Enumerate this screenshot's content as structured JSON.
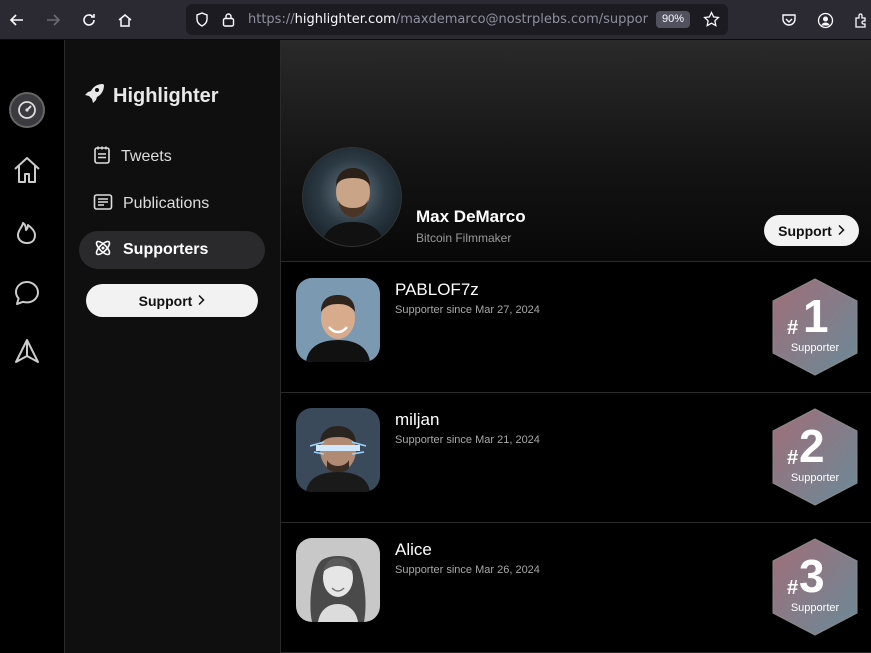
{
  "browser": {
    "url_prefix": "https://",
    "url_host": "highlighter.com",
    "url_path": "/maxdemarco@nostrplebs.com/suppor",
    "zoom": "90%"
  },
  "rail": {
    "icons": [
      "dashboard-icon",
      "home-icon",
      "flame-icon",
      "chat-icon",
      "send-icon"
    ]
  },
  "sidebar": {
    "brand": "Highlighter",
    "items": [
      {
        "label": "Tweets",
        "icon": "notes-icon",
        "active": false
      },
      {
        "label": "Publications",
        "icon": "newspaper-icon",
        "active": false
      },
      {
        "label": "Supporters",
        "icon": "atom-icon",
        "active": true
      }
    ],
    "support_label": "Support"
  },
  "profile": {
    "name": "Max DeMarco",
    "subtitle": "Bitcoin Filmmaker",
    "support_label": "Support"
  },
  "supporters": [
    {
      "name": "PABLOF7z",
      "since": "Supporter since Mar 27, 2024",
      "rank_hash": "#",
      "rank": "1",
      "rank_label": "Supporter"
    },
    {
      "name": "miljan",
      "since": "Supporter since Mar 21, 2024",
      "rank_hash": "#",
      "rank": "2",
      "rank_label": "Supporter"
    },
    {
      "name": "Alice",
      "since": "Supporter since Mar 26, 2024",
      "rank_hash": "#",
      "rank": "3",
      "rank_label": "Supporter"
    }
  ],
  "colors": {
    "accent_button": "#f2f2f2",
    "badge_from": "#a06e78",
    "badge_to": "#6a8a98"
  }
}
